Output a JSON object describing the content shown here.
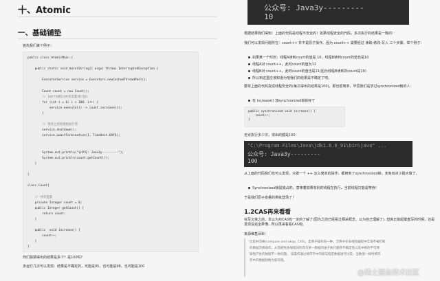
{
  "left": {
    "section_title": "十、Atomic",
    "subsection_title": "一、基础铺垫",
    "intro": "首先我们来个例子：",
    "code": [
      "public class AtomicMain {",
      "",
      "    public static void main(String[] args) throws InterruptedException {",
      "",
      "        ExecutorService service = Executors.newCachedThreadPool();",
      "",
      "        Count count = new Count();",
      "        // 100个线程对共享变量进行加1",
      "        for (int i = 0; i < 100; i++) {",
      "            service.execute(() -> count.increase());",
      "        }",
      "",
      "        // 等待上述的线程执行完",
      "        service.shutdown();",
      "        service.awaitTermination(1, TimeUnit.DAYS);",
      "",
      "",
      "        System.out.println(\"公众号: Java3y---------\");",
      "        System.out.println(count.getCount());",
      "    }",
      "",
      "}",
      "",
      "class Count{",
      "",
      "    // 共享变量",
      "    private Integer count = 0;",
      "    public Integer getCount() {",
      "        return count;",
      "    }",
      "",
      "    public  void increase() {",
      "        count++;",
      "    }",
      "}"
    ],
    "question": "你们猜猜得出的结果是多少？是100吗？",
    "result_line": "多运行几次可以发现：结果是不确定的，可能是95，也可能是98，也可能是100"
  },
  "right": {
    "top_terminal": [
      "公众号: Java3y---------",
      "10"
    ],
    "p1": "根据结果我们得知：上面的代码是线程不安全的！如果线程安全的代码，多次执行的结果是一致的！",
    "p2": "我们可以发现问题所在：count++ 并不是原子操作。因为 count++ 需要经过 读取-修改-写入 三个步骤。举个例子：",
    "bullets": [
      "如果某一个时刻：线程A读到count的值是 10，线程B读到count的值也是10",
      "线程A对 count++，此时count的值为11",
      "线程B对 count++，此时count的值也是11(因为线程B读到的count是10)",
      "所以到这里应该知道为啥我们的结果是不确定了吧。"
    ],
    "p3": "要将上面的代码变成线程安全的(每次得出的结果是100)，那也很简单，毕竟我们是学过synchronized锁的人：",
    "bullet_sync": "在 increase() 加synchronized锁就好了",
    "sync_code": [
      "public synchronized void increase() {",
      "    count++;",
      "}"
    ],
    "p4": "无论执行多少次，得出的都是100：",
    "terminal": [
      "\"C:\\Program Files\\Java\\jdk1.8.0_91\\bin\\java\" ...",
      "公众号: Java3y---------",
      "100"
    ],
    "p5": "从上面的代码我们也可以发现，只做一个 ++ 这么简单的操作，都用到了synchronized锁，未免有点小题大做了。",
    "bullet_lock": "Synchronized锁是独占的，意味着如果有别的线程在执行，当前线程只能是等待！",
    "p6": "于是我们原子变量的类就登场了！",
    "heading": "1.2CAS再来看看",
    "p7": "在写文章之前，本以为对CAS有一定的了解了(因为之前已经看过相关概念，以为自己理解了)..但真正敲起键盘写的时候，还是发现没完全弄懂...所以再来看看CAS吧。",
    "p8": "来源维基百科：",
    "quote": [
      "比较并交换(compare and swap, CAS)，是原子操作的一种，可用于在多线程编程中实现不被打断",
      "的数据交换操作，从而避免多线程同时改写某一数据时由于执行顺序不确定性以及中断的不可预",
      "知性产生的数据不一致问题。 该操作通过将内存中的值与指定数据进行比较，当数值一样时将内",
      "存中的数据替换为新的值。"
    ],
    "watermark": "@稀土掘金技术社区"
  }
}
